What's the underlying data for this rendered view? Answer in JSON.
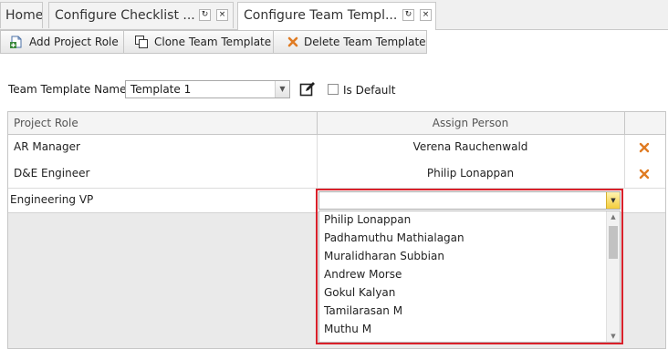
{
  "tabs": [
    {
      "label": "Home"
    },
    {
      "label": "Configure Checklist ..."
    },
    {
      "label": "Configure Team Templ..."
    }
  ],
  "toolbar": {
    "add_label": "Add Project Role",
    "clone_label": "Clone Team Template",
    "delete_label": "Delete Team Template"
  },
  "template": {
    "name_label": "Team Template Name:",
    "selected": "Template 1",
    "is_default_label": "Is Default",
    "is_default_checked": false
  },
  "grid": {
    "headers": {
      "role": "Project Role",
      "person": "Assign Person"
    },
    "rows": [
      {
        "role": "AR Manager",
        "person": "Verena Rauchenwald"
      },
      {
        "role": "D&E Engineer",
        "person": "Philip Lonappan"
      },
      {
        "role": "Engineering VP",
        "person": ""
      }
    ]
  },
  "dropdown": {
    "options": [
      "Philip Lonappan",
      "Padhamuthu Mathialagan",
      "Muralidharan Subbian",
      "Andrew Morse",
      "Gokul Kalyan",
      "Tamilarasan M",
      "Muthu M"
    ]
  },
  "colors": {
    "highlight": "#d9202a",
    "delete": "#e07b22",
    "toggle": "#f4cc3a"
  }
}
